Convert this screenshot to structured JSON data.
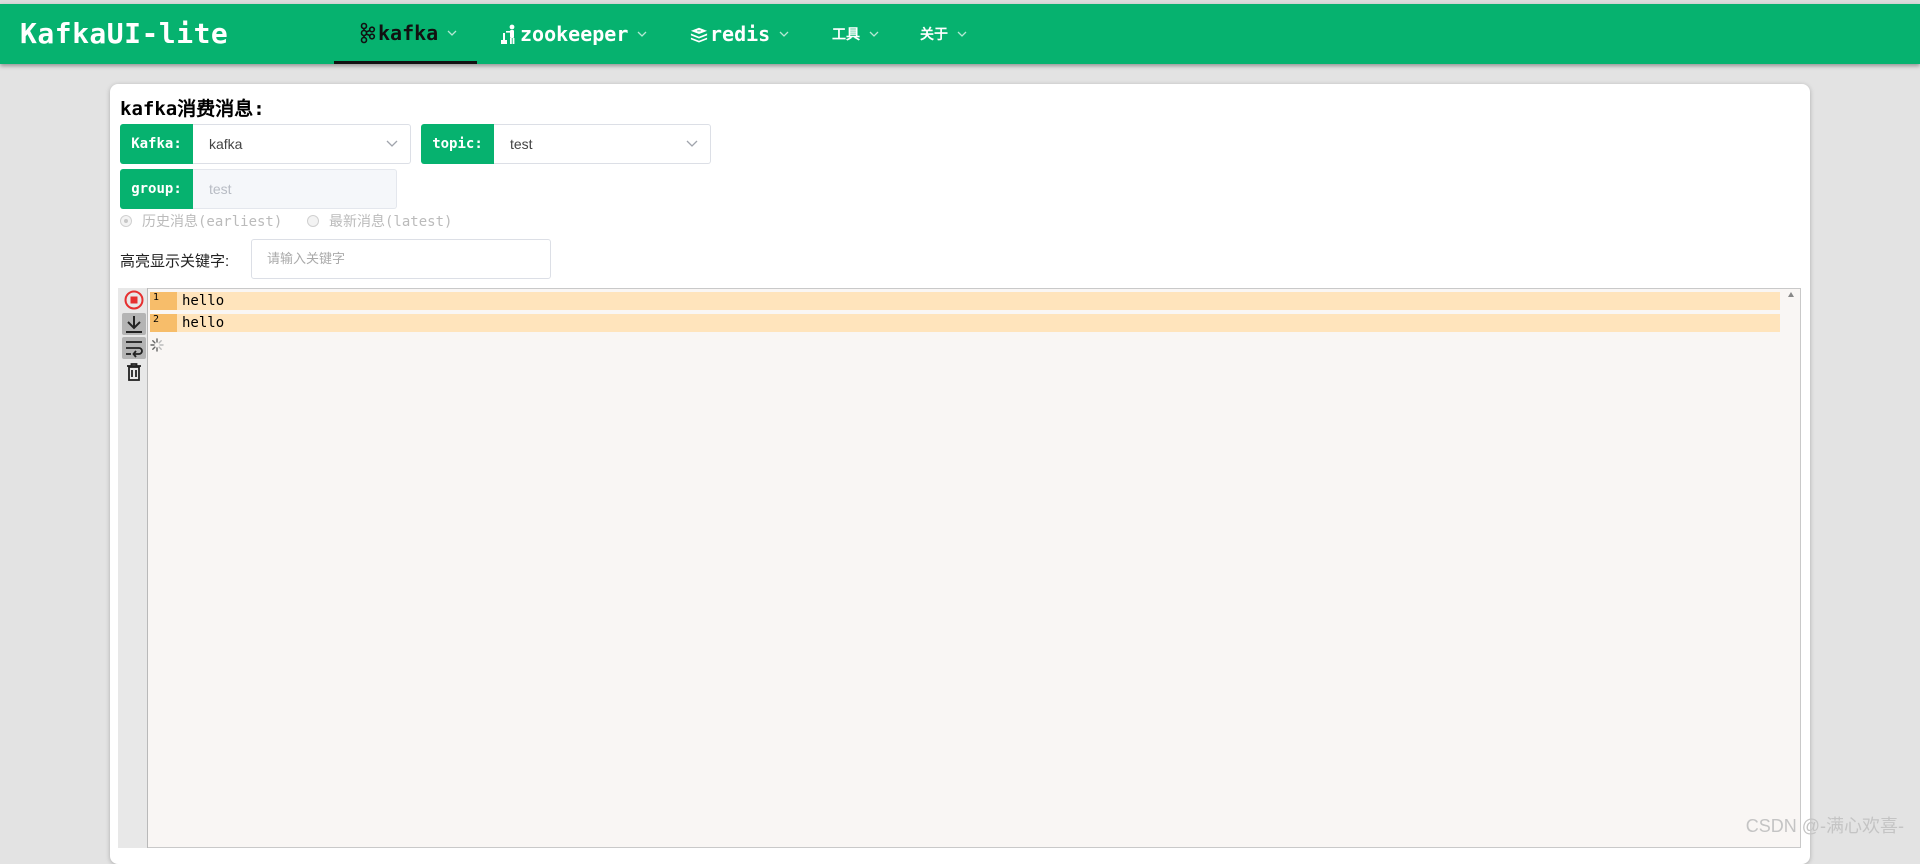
{
  "app": {
    "brand": "KafkaUI-lite"
  },
  "nav": [
    {
      "label": "kafka",
      "icon": "kafka-icon",
      "active": true
    },
    {
      "label": "zookeeper",
      "icon": "zookeeper-icon",
      "active": false
    },
    {
      "label": "redis",
      "icon": "redis-icon",
      "active": false
    },
    {
      "label": "工具",
      "active": false
    },
    {
      "label": "关于",
      "active": false
    }
  ],
  "page": {
    "title": "kafka消费消息:"
  },
  "form": {
    "kafka_label": "Kafka:",
    "kafka_value": "kafka",
    "topic_label": "topic:",
    "topic_value": "test",
    "group_label": "group:",
    "group_value": "test",
    "offset_options": [
      "历史消息(earliest)",
      "最新消息(latest)"
    ],
    "offset_selected": "历史消息(earliest)",
    "highlight_label": "高亮显示关键字:",
    "highlight_placeholder": "请输入关键字"
  },
  "console": {
    "tools": [
      "stop-icon",
      "scroll-bottom-icon",
      "wrap-icon",
      "trash-icon"
    ],
    "lines": [
      {
        "num": "1",
        "text": "hello"
      },
      {
        "num": "2",
        "text": "hello"
      }
    ],
    "loading": true
  },
  "watermark": "CSDN @-满心欢喜-",
  "colors": {
    "primary": "#06b26f",
    "line_bg": "#ffe4bc",
    "line_num_bg": "#f7bd6a",
    "stop": "#e63030"
  }
}
